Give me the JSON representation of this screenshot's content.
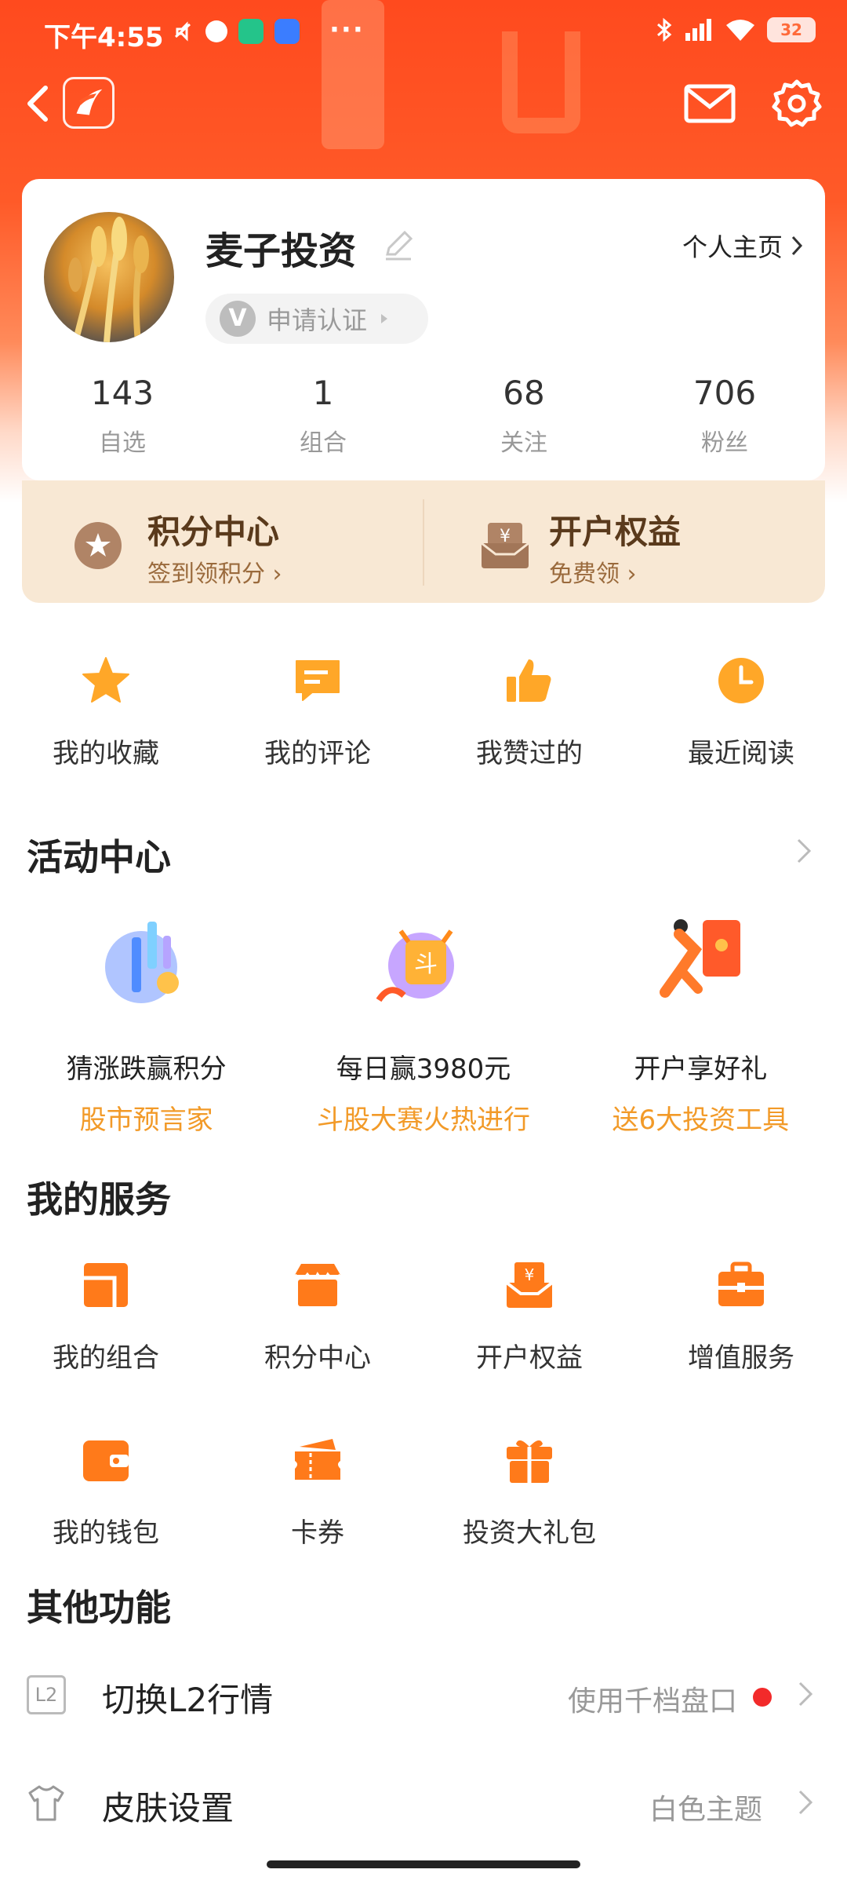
{
  "status_bar": {
    "time": "下午4:55",
    "more": "···",
    "battery": "32"
  },
  "profile": {
    "username": "麦子投资",
    "homepage_link": "个人主页",
    "verify_label": "申请认证",
    "verify_badge": "V",
    "stats": [
      {
        "value": "143",
        "label": "自选"
      },
      {
        "value": "1",
        "label": "组合"
      },
      {
        "value": "68",
        "label": "关注"
      },
      {
        "value": "706",
        "label": "粉丝"
      }
    ]
  },
  "promo": {
    "points": {
      "title": "积分中心",
      "sub": "签到领积分"
    },
    "account": {
      "title": "开户权益",
      "sub": "免费领"
    }
  },
  "quick_links": [
    {
      "label": "我的收藏",
      "icon": "star-icon"
    },
    {
      "label": "我的评论",
      "icon": "comment-icon"
    },
    {
      "label": "我赞过的",
      "icon": "thumbs-up-icon"
    },
    {
      "label": "最近阅读",
      "icon": "clock-icon"
    }
  ],
  "activity_center": {
    "title": "活动中心",
    "items": [
      {
        "title": "猜涨跌赢积分",
        "sub": "股市预言家"
      },
      {
        "title": "每日赢3980元",
        "sub": "斗股大赛火热进行"
      },
      {
        "title": "开户享好礼",
        "sub": "送6大投资工具"
      }
    ]
  },
  "my_services": {
    "title": "我的服务",
    "items": [
      {
        "label": "我的组合",
        "icon": "portfolio-icon"
      },
      {
        "label": "积分中心",
        "icon": "store-icon"
      },
      {
        "label": "开户权益",
        "icon": "yuan-box-icon"
      },
      {
        "label": "增值服务",
        "icon": "briefcase-icon"
      },
      {
        "label": "我的钱包",
        "icon": "wallet-icon"
      },
      {
        "label": "卡券",
        "icon": "ticket-icon"
      },
      {
        "label": "投资大礼包",
        "icon": "gift-icon"
      }
    ]
  },
  "other_functions": {
    "title": "其他功能",
    "l2": {
      "label": "切换L2行情",
      "value": "使用千档盘口",
      "icon_text": "L2"
    },
    "skin": {
      "label": "皮肤设置",
      "value": "白色主题"
    }
  },
  "colors": {
    "brand": "#ff4a1e",
    "accent": "#f29a28",
    "icon_orange": "#ff7a1a"
  }
}
